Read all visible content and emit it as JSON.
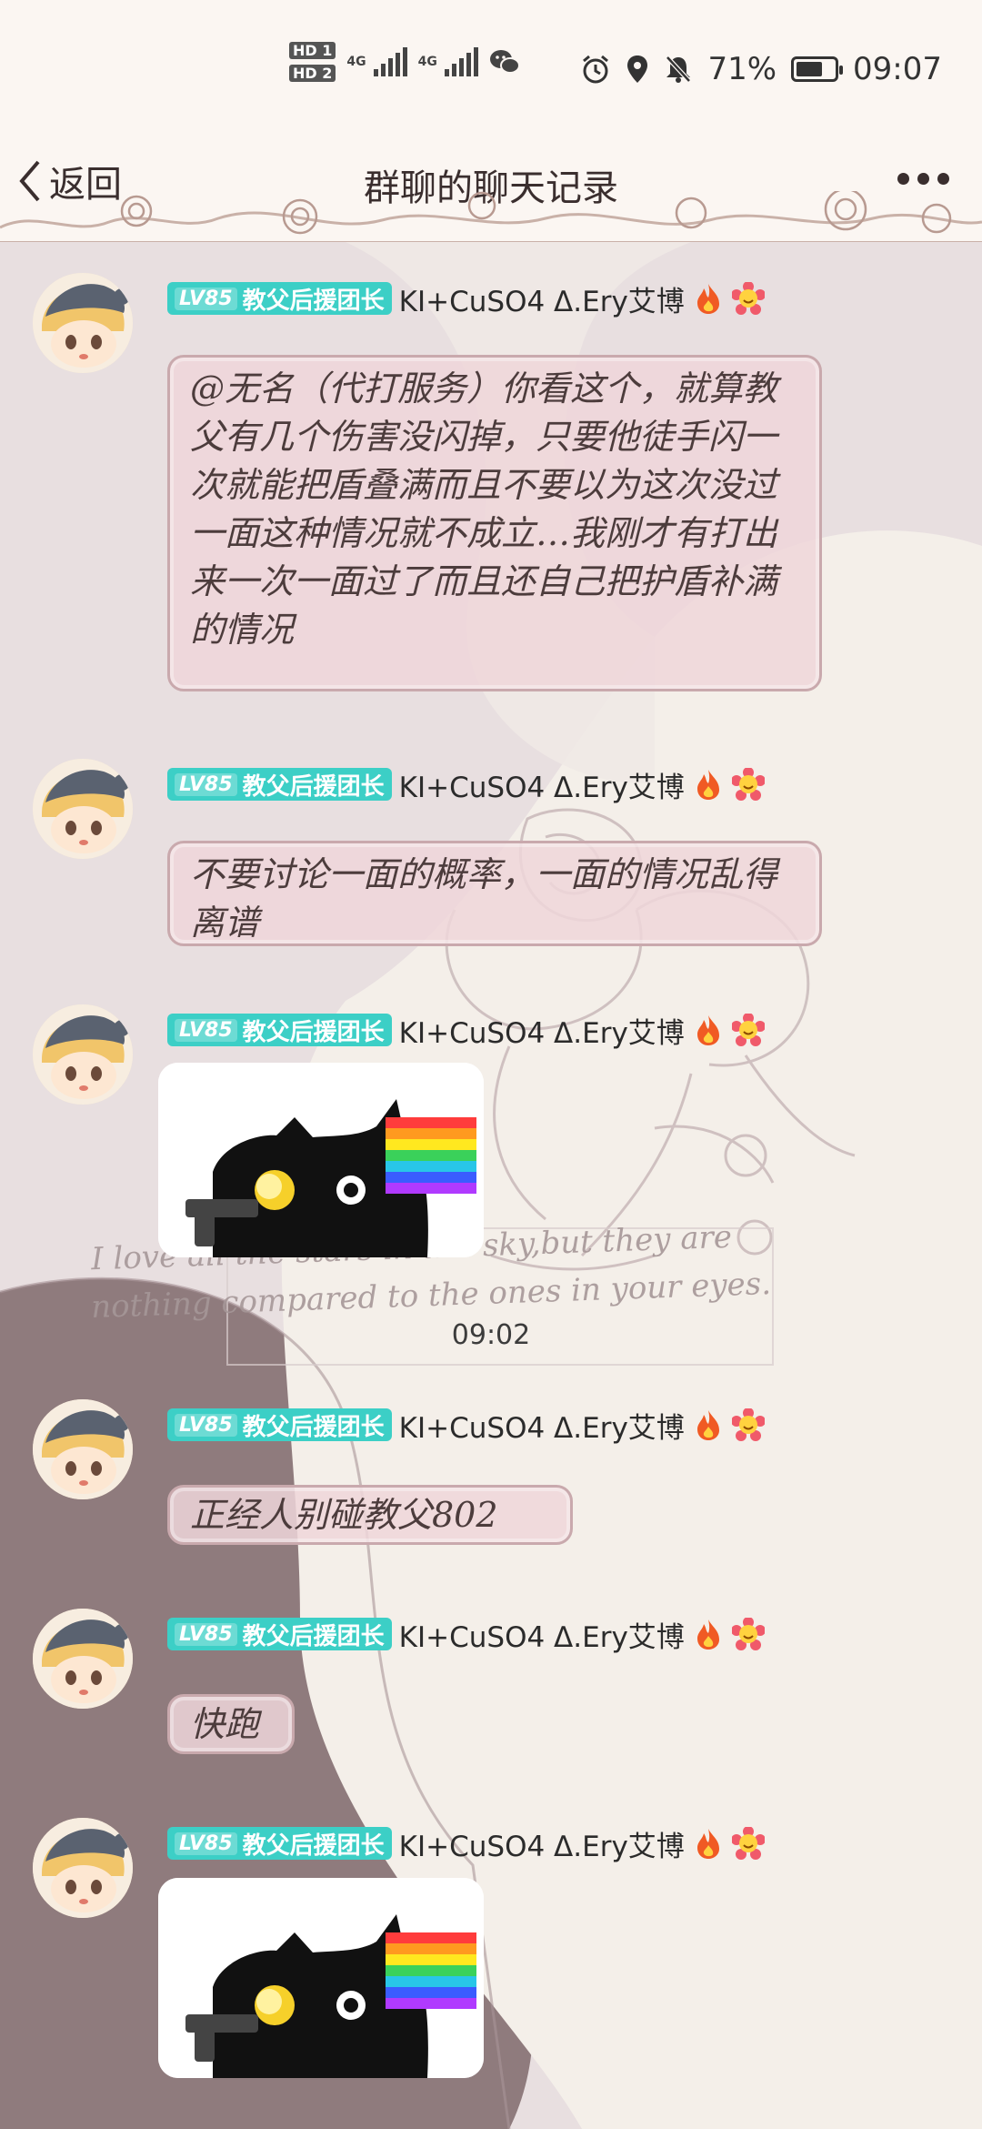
{
  "status_bar": {
    "sim1": "HD 1",
    "sim2": "HD 2",
    "net1": "4G",
    "net2": "4G",
    "battery_percent": "71%",
    "battery_level": 0.71,
    "time": "09:07",
    "icons": [
      "wechat-icon",
      "alarm-icon",
      "location-icon",
      "mute-icon",
      "battery-icon"
    ]
  },
  "header": {
    "back_label": "返回",
    "title": "群聊的聊天记录",
    "more_icon": "more-icon"
  },
  "background_script": {
    "line1": "I love all the stars in the sky,but they are",
    "line2": "nothing compared to the ones in your eyes."
  },
  "messages": [
    {
      "level": "LV85",
      "title_badge": "教父后援团长",
      "nickname": "KI+CuSO4 Δ.Ery艾博",
      "type": "text",
      "text": "@无名（代打服务）你看这个，就算教父有几个伤害没闪掉，只要他徒手闪一次就能把盾叠满而且不要以为这次没过一面这种情况就不成立…我刚才有打出来一次一面过了而且还自己把护盾补满的情况"
    },
    {
      "level": "LV85",
      "title_badge": "教父后援团长",
      "nickname": "KI+CuSO4 Δ.Ery艾博",
      "type": "text",
      "text": "不要讨论一面的概率，一面的情况乱得离谱"
    },
    {
      "level": "LV85",
      "title_badge": "教父后援团长",
      "nickname": "KI+CuSO4 Δ.Ery艾博",
      "type": "sticker",
      "sticker": "black-cat-gun-sticker"
    },
    {
      "level": "LV85",
      "title_badge": "教父后援团长",
      "nickname": "KI+CuSO4 Δ.Ery艾博",
      "type": "text",
      "text": "正经人别碰教父802"
    },
    {
      "level": "LV85",
      "title_badge": "教父后援团长",
      "nickname": "KI+CuSO4 Δ.Ery艾博",
      "type": "text",
      "text": "快跑"
    },
    {
      "level": "LV85",
      "title_badge": "教父后援团长",
      "nickname": "KI+CuSO4 Δ.Ery艾博",
      "type": "sticker",
      "sticker": "black-cat-gun-sticker"
    }
  ],
  "time_divider": "09:02",
  "colors": {
    "badge": "#3ccfc6",
    "bubble": "#eed6d9",
    "bubble_border": "#c9a9ad",
    "bg_dark": "#8f7b7d",
    "bg_light": "#f4efe9"
  }
}
